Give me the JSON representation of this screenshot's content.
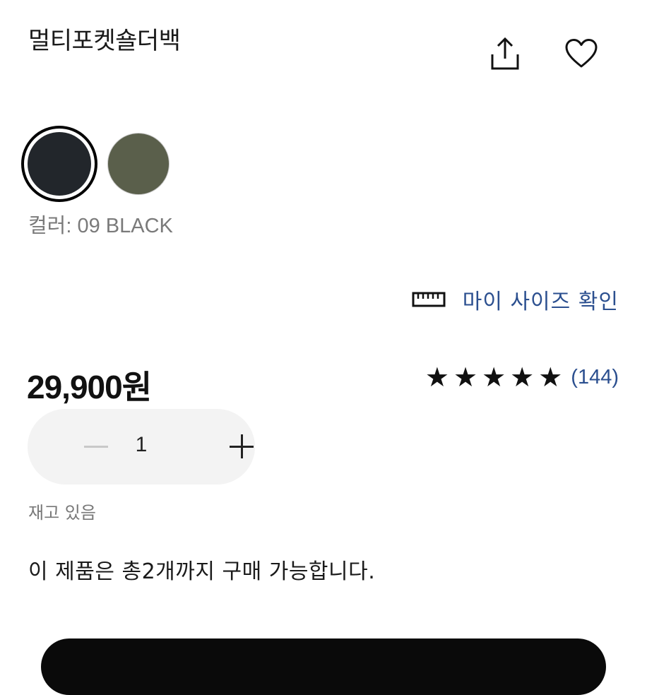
{
  "product": {
    "title": "멀티포켓숄더백"
  },
  "actions": {
    "share_icon": "share-icon",
    "favorite_icon": "heart-icon"
  },
  "colors": {
    "swatches": [
      {
        "name": "09 BLACK",
        "hex": "#22262b",
        "selected": true
      },
      {
        "name": "olive",
        "hex": "#5a5f4b",
        "selected": false
      }
    ],
    "label_prefix": "컬러:",
    "selected_name": "09 BLACK"
  },
  "size_check": {
    "icon": "ruler-icon",
    "label": "마이 사이즈 확인"
  },
  "price": "29,900원",
  "rating": {
    "stars": 5,
    "review_count": "(144)"
  },
  "quantity": {
    "value": "1",
    "minus_icon": "minus-icon",
    "plus_icon": "plus-icon"
  },
  "stock_status": "재고 있음",
  "purchase_limit": "이 제품은 총2개까지 구매 가능합니다.",
  "theme": {
    "link_color": "#2b4f8f",
    "text_color": "#111111",
    "muted_color": "#777777",
    "stepper_bg": "#f3f3f3"
  }
}
